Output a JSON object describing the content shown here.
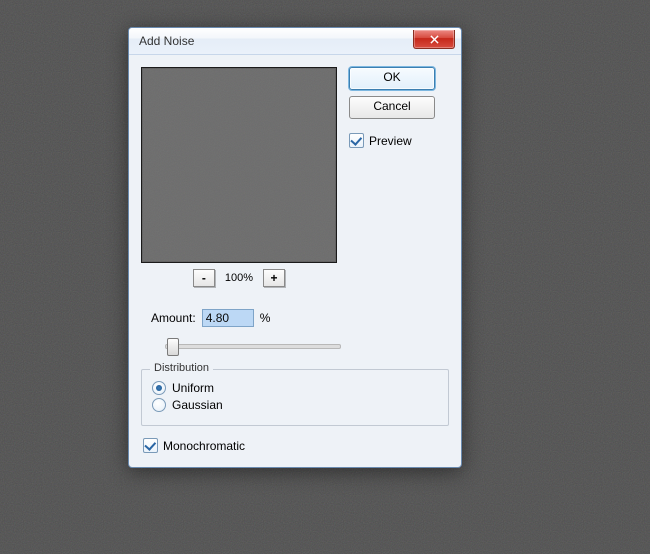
{
  "dialog": {
    "title": "Add Noise",
    "close_label": "Close"
  },
  "buttons": {
    "ok": "OK",
    "cancel": "Cancel"
  },
  "preview": {
    "checkbox_label": "Preview",
    "checked": true
  },
  "zoom": {
    "minus": "-",
    "plus": "+",
    "value": "100%"
  },
  "amount": {
    "label": "Amount:",
    "value": "4.80",
    "unit": "%"
  },
  "distribution": {
    "legend": "Distribution",
    "options": {
      "uniform": "Uniform",
      "gaussian": "Gaussian"
    },
    "selected": "uniform"
  },
  "monochromatic": {
    "label": "Monochromatic",
    "checked": true
  }
}
